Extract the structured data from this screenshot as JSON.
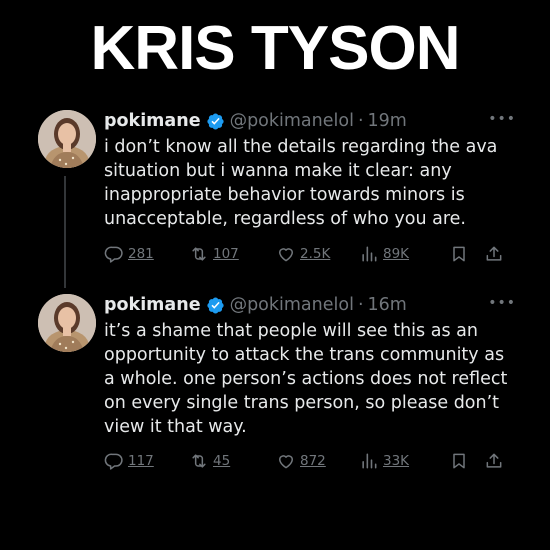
{
  "headline": "KRIS TYSON",
  "tweets": [
    {
      "name": "pokimane",
      "handle": "@pokimanelol",
      "separator": "·",
      "time": "19m",
      "more": "•••",
      "text": "i don’t know all the details regarding the ava\nsituation but i wanna make it clear: any\ninappropriate behavior towards minors is\nunacceptable, regardless of who you are.",
      "replies": "281",
      "retweets": "107",
      "likes": "2.5K",
      "views": "89K"
    },
    {
      "name": "pokimane",
      "handle": "@pokimanelol",
      "separator": "·",
      "time": "16m",
      "more": "•••",
      "text": "it’s a shame that people will see this as an\nopportunity to attack the trans community as\na whole. one person’s actions does not reflect\non every single trans person, so please don’t\nview it that way.",
      "replies": "117",
      "retweets": "45",
      "likes": "872",
      "views": "33K"
    }
  ],
  "icons": {
    "verified": "verified-badge-icon",
    "reply": "reply-icon",
    "retweet": "retweet-icon",
    "like": "heart-icon",
    "views": "views-icon",
    "bookmark": "bookmark-icon",
    "share": "share-icon"
  },
  "colors": {
    "background": "#000000",
    "text": "#e7e9ea",
    "muted": "#71767b",
    "verified": "#1d9bf0"
  }
}
